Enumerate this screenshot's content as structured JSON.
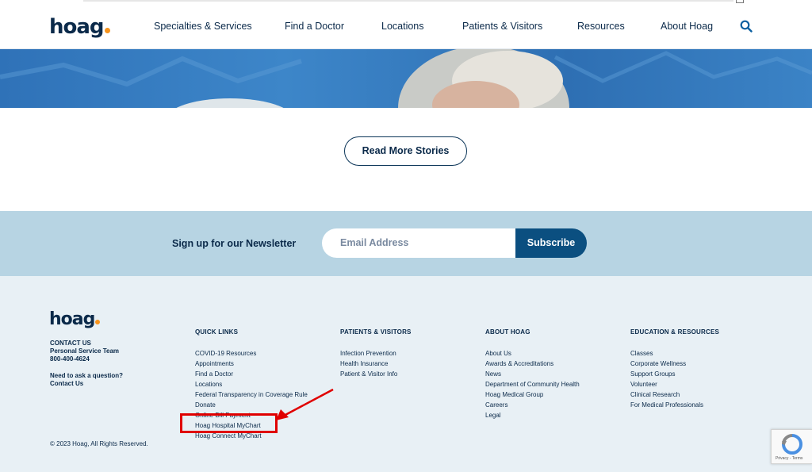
{
  "nav": {
    "logo": "hoag",
    "items": [
      "Specialties & Services",
      "Find a Doctor",
      "Locations",
      "Patients & Visitors",
      "Resources",
      "About Hoag"
    ]
  },
  "main": {
    "read_more_label": "Read More Stories"
  },
  "newsletter": {
    "label": "Sign up for our Newsletter",
    "email_placeholder": "Email Address",
    "subscribe_label": "Subscribe"
  },
  "footer": {
    "logo": "hoag",
    "contact": {
      "heading": "CONTACT US",
      "team": "Personal Service Team",
      "phone": "800-400-4624",
      "question": "Need to ask a question?",
      "contact_link": "Contact Us"
    },
    "copyright": "© 2023 Hoag, All Rights Reserved.",
    "columns": [
      {
        "title": "QUICK LINKS",
        "links": [
          "COVID-19 Resources",
          "Appointments",
          "Find a Doctor",
          "Locations",
          "Federal Transparency in Coverage Rule",
          "Donate",
          "Online Bill Payment",
          "Hoag Hospital MyChart",
          "Hoag Connect MyChart"
        ]
      },
      {
        "title": "PATIENTS & VISITORS",
        "links": [
          "Infection Prevention",
          "Health Insurance",
          "Patient & Visitor Info"
        ]
      },
      {
        "title": "ABOUT HOAG",
        "links": [
          "About Us",
          "Awards & Accreditations",
          "News",
          "Department of Community Health",
          "Hoag Medical Group",
          "Careers",
          "Legal"
        ]
      },
      {
        "title": "EDUCATION & RESOURCES",
        "links": [
          "Classes",
          "Corporate Wellness",
          "Support Groups",
          "Volunteer",
          "Clinical Research",
          "For Medical Professionals"
        ]
      }
    ]
  },
  "recaptcha": {
    "text": "Privacy - Terms"
  },
  "colors": {
    "navy": "#0b2a4a",
    "accent_orange": "#f7941d",
    "subscribe_blue": "#0b4f80",
    "newsletter_bg": "#b7d4e3",
    "footer_bg": "#e8f0f5",
    "highlight_red": "#e00000"
  }
}
